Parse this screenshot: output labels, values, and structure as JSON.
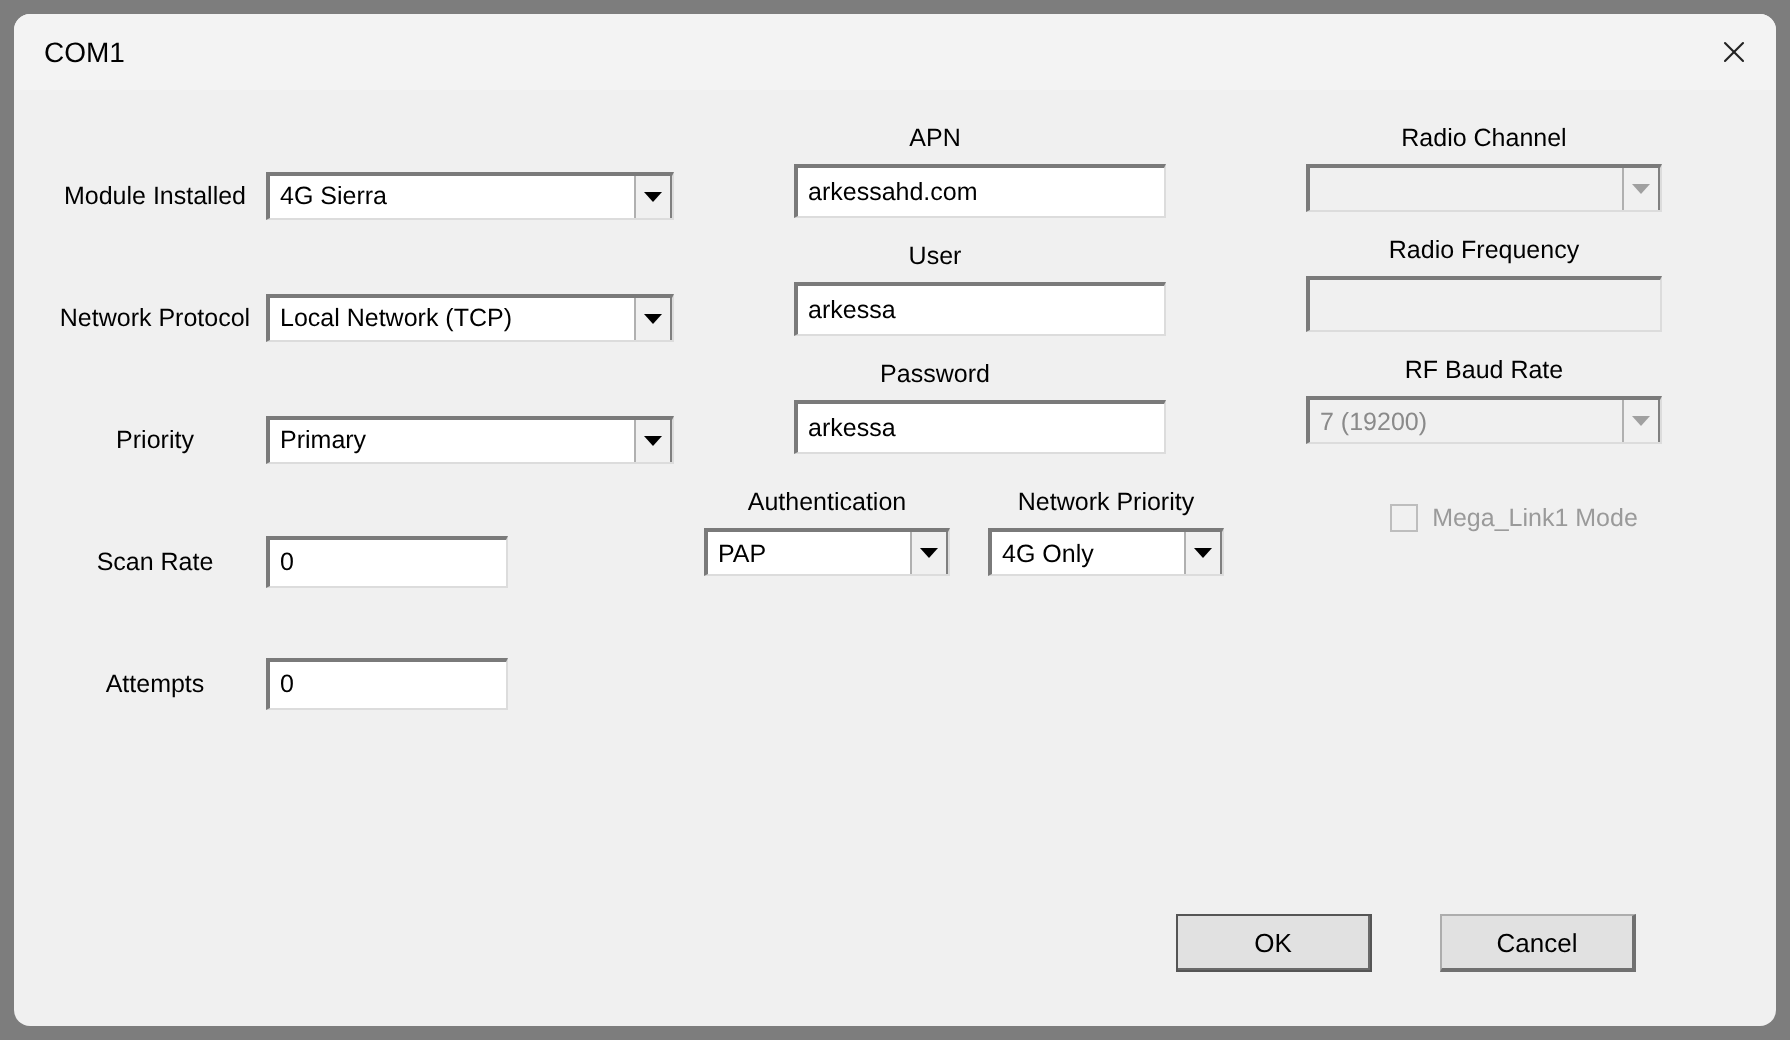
{
  "window": {
    "title": "COM1"
  },
  "left_fields": [
    {
      "label": "Module Installed",
      "kind": "combo",
      "value": "4G Sierra"
    },
    {
      "label": "Network Protocol",
      "kind": "combo",
      "value": "Local Network (TCP)"
    },
    {
      "label": "Priority",
      "kind": "combo",
      "value": "Primary"
    },
    {
      "label": "Scan Rate",
      "kind": "text",
      "value": "0"
    },
    {
      "label": "Attempts",
      "kind": "text",
      "value": "0"
    }
  ],
  "middle_fields": [
    {
      "label": "APN",
      "value": "arkessahd.com"
    },
    {
      "label": "User",
      "value": "arkessa"
    },
    {
      "label": "Password",
      "value": "arkessa"
    }
  ],
  "middle_combos": [
    {
      "label": "Authentication",
      "value": "PAP"
    },
    {
      "label": "Network Priority",
      "value": "4G Only"
    }
  ],
  "right_fields": [
    {
      "label": "Radio Channel",
      "kind": "combo",
      "disabled": true
    },
    {
      "label": "Radio Frequency",
      "kind": "text",
      "disabled": true
    },
    {
      "label": "RF Baud Rate",
      "kind": "combo",
      "value": "7 (19200)",
      "disabled": true
    }
  ],
  "mode_checkbox": {
    "label": "Mega_Link1 Mode",
    "checked": false,
    "disabled": true
  },
  "buttons": [
    {
      "label": "OK",
      "default": true
    },
    {
      "label": "Cancel",
      "default": false
    }
  ]
}
